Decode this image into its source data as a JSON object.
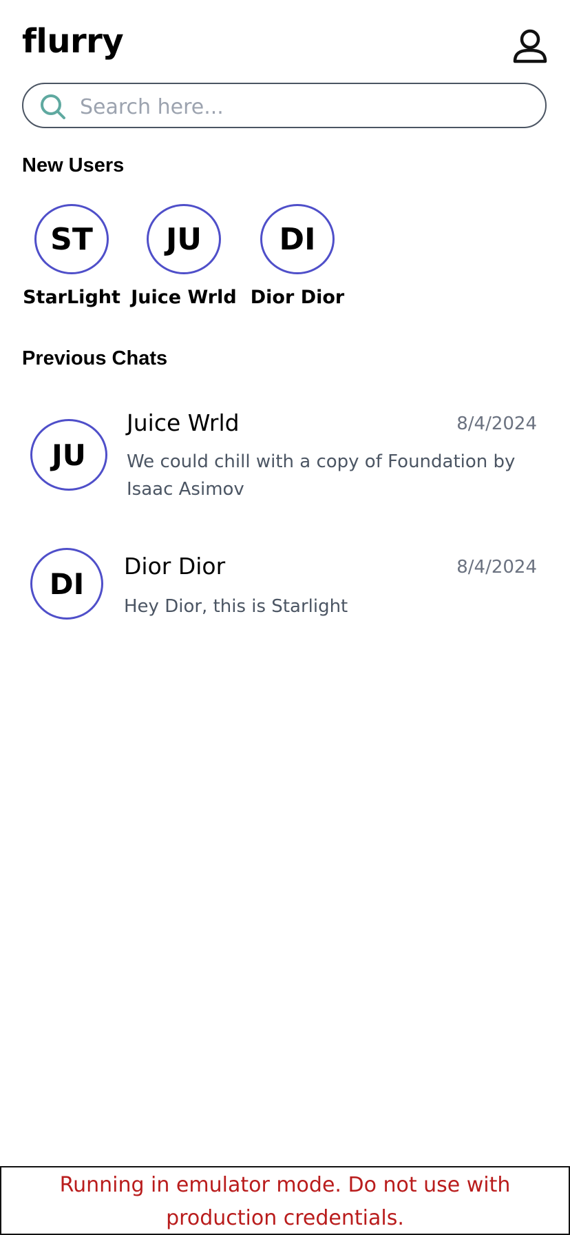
{
  "header": {
    "app_title": "flurry",
    "profile_icon": "user-profile-icon"
  },
  "search": {
    "placeholder": "Search here...",
    "value": "",
    "icon": "search-icon",
    "icon_color": "#5fa9a0"
  },
  "new_users": {
    "heading": "New Users",
    "items": [
      {
        "initials": "ST",
        "name": "StarLight"
      },
      {
        "initials": "JU",
        "name": "Juice Wrld"
      },
      {
        "initials": "DI",
        "name": "Dior Dior"
      }
    ]
  },
  "previous_chats": {
    "heading": "Previous Chats",
    "items": [
      {
        "initials": "JU",
        "name": "Juice Wrld",
        "date": "8/4/2024",
        "message": "We could chill with a copy of Foundation by Isaac Asimov"
      },
      {
        "initials": "DI",
        "name": "Dior Dior",
        "date": "8/4/2024",
        "message": "Hey Dior, this is Starlight"
      }
    ]
  },
  "banner": {
    "text": "Running in emulator mode. Do not use with production credentials."
  },
  "colors": {
    "avatar_border": "#4f4fc9",
    "banner_text": "#b91c1c",
    "search_border": "#4b5563"
  }
}
